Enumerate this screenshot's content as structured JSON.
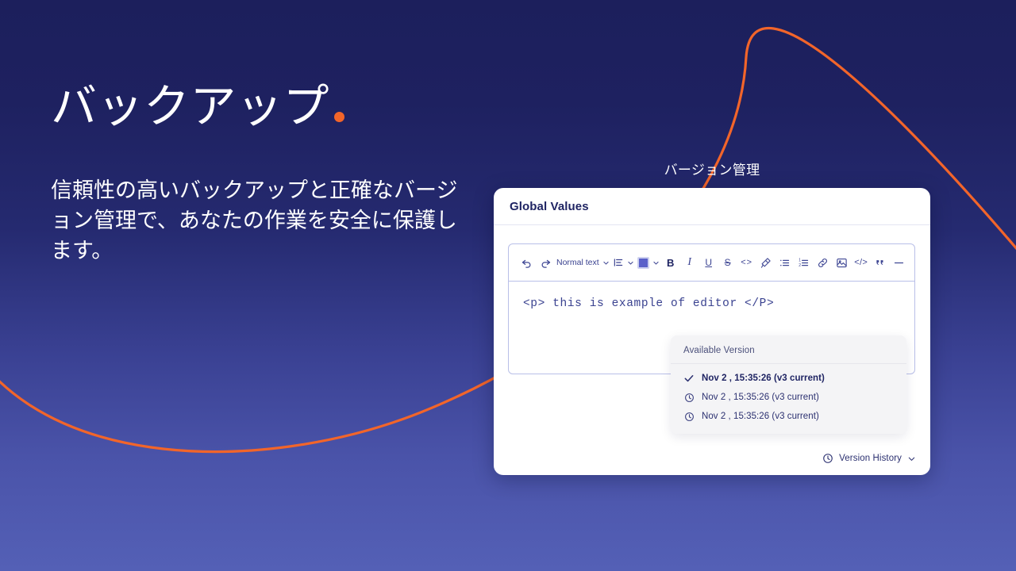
{
  "slide": {
    "title": "バックアップ",
    "title_dot": "orange-dot",
    "body": "信頼性の高いバックアップと正確なバージョン管理で、あなたの作業を安全に保護します。",
    "caption": "バージョン管理",
    "colors": {
      "bg_top": "#1c1f5c",
      "bg_bottom": "#5460b6",
      "accent_orange": "#f2652a",
      "card_bg": "#ffffff",
      "ink": "#1f2463",
      "editor_border": "#b9bfe8",
      "dropdown_bg": "#f4f4f6",
      "swatch": "#5b61c9"
    }
  },
  "card": {
    "title": "Global Values",
    "editor": {
      "toolbar": {
        "undo": "undo-icon",
        "redo": "redo-icon",
        "block_style": "Normal text",
        "align": "align-icon",
        "color_swatch": "#5b61c9",
        "bold": "B",
        "italic": "I",
        "underline": "U",
        "strikethrough": "S",
        "inline_code": "<>",
        "clear_format": "clear-format-icon",
        "bullet_list": "bullet-list-icon",
        "numbered_list": "numbered-list-icon",
        "link": "link-icon",
        "image": "image-icon",
        "code_block": "</>",
        "quote": "quote-icon",
        "divider": "horizontal-rule-icon"
      },
      "content": "<p> this is example of editor </P>"
    },
    "dropdown": {
      "header": "Available Version",
      "items": [
        {
          "label": "Nov 2 , 15:35:26 (v3 current)",
          "icon": "check-icon",
          "current": true
        },
        {
          "label": "Nov 2 , 15:35:26 (v3 current)",
          "icon": "clock-icon",
          "current": false
        },
        {
          "label": "Nov 2 , 15:35:26 (v3 current)",
          "icon": "clock-icon",
          "current": false
        }
      ]
    },
    "footer": {
      "label": "Version History",
      "icon": "clock-icon",
      "chevron": "chevron-down-icon"
    }
  }
}
